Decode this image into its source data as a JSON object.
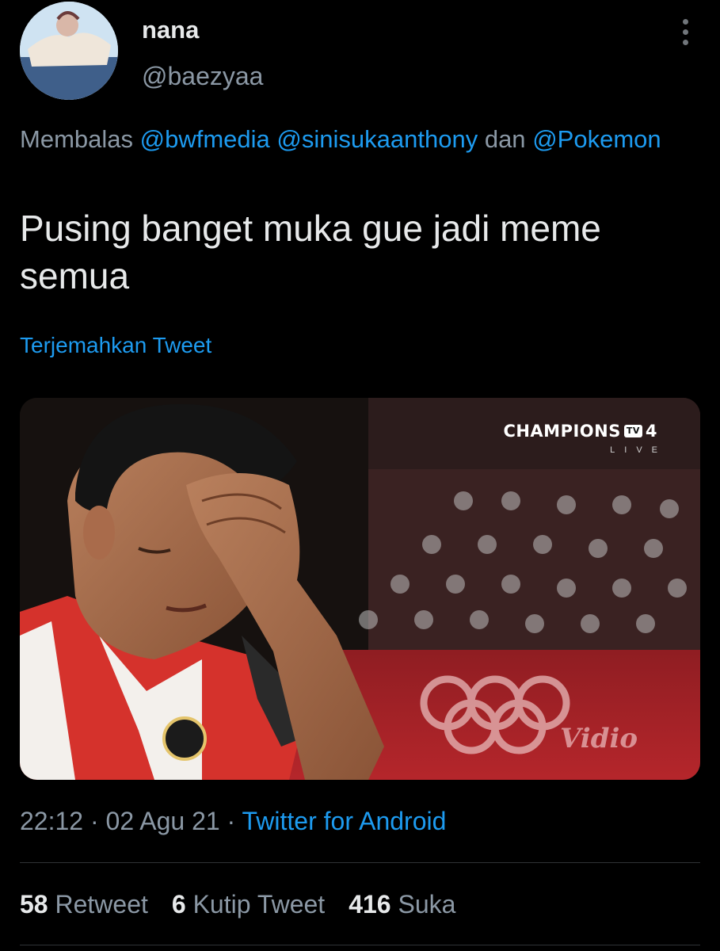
{
  "user": {
    "display_name": "nana",
    "handle": "@baezyaa"
  },
  "reply": {
    "prefix": "Membalas",
    "mention_1": "@bwfmedia",
    "mention_2": "@sinisukaanthony",
    "conjunction": "dan",
    "mention_3": "@Pokemon"
  },
  "tweet": {
    "text": "Pusing banget muka gue jadi meme semua",
    "translate_label": "Terjemahkan Tweet"
  },
  "media": {
    "broadcaster": "CHAMPIONS",
    "broadcaster_badge": "TV",
    "broadcaster_number": "4",
    "broadcaster_sub": "LIVE",
    "watermark": "Vidio"
  },
  "meta": {
    "time": "22:12",
    "separator": "·",
    "date": "02 Agu 21",
    "source": "Twitter for Android"
  },
  "stats": {
    "retweets_count": "58",
    "retweets_label": "Retweet",
    "quotes_count": "6",
    "quotes_label": "Kutip Tweet",
    "likes_count": "416",
    "likes_label": "Suka"
  },
  "icons": {
    "more": "more-vertical-icon"
  },
  "colors": {
    "background": "#000000",
    "link": "#1d9bf0",
    "secondary_text": "#8b98a5",
    "primary_text": "#e7e9ea"
  }
}
